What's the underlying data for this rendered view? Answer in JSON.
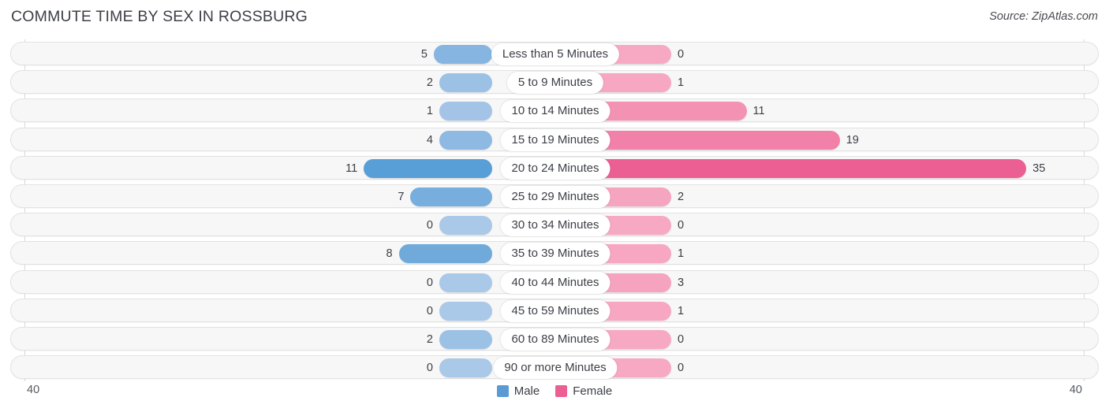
{
  "header": {
    "title": "COMMUTE TIME BY SEX IN ROSSBURG",
    "source": "Source: ZipAtlas.com"
  },
  "legend": {
    "items": [
      {
        "label": "Male",
        "color": "#5b9bd5"
      },
      {
        "label": "Female",
        "color": "#ec5f92"
      }
    ]
  },
  "axis": {
    "left_label": "40",
    "right_label": "40",
    "max": 40
  },
  "chart_data": {
    "type": "bar",
    "subtype": "diverging-bidirectional",
    "title": "COMMUTE TIME BY SEX IN ROSSBURG",
    "xlabel": "",
    "ylabel": "",
    "xlim": [
      40,
      0,
      40
    ],
    "grid": false,
    "legend_position": "bottom-center",
    "categories": [
      "Less than 5 Minutes",
      "5 to 9 Minutes",
      "10 to 14 Minutes",
      "15 to 19 Minutes",
      "20 to 24 Minutes",
      "25 to 29 Minutes",
      "30 to 34 Minutes",
      "35 to 39 Minutes",
      "40 to 44 Minutes",
      "45 to 59 Minutes",
      "60 to 89 Minutes",
      "90 or more Minutes"
    ],
    "series": [
      {
        "name": "Male",
        "direction": "left",
        "color": "#5b9bd5",
        "values": [
          5,
          2,
          1,
          4,
          11,
          7,
          0,
          8,
          0,
          0,
          2,
          0
        ]
      },
      {
        "name": "Female",
        "direction": "right",
        "color": "#ec5f92",
        "values": [
          0,
          1,
          11,
          19,
          35,
          2,
          0,
          1,
          3,
          1,
          0,
          0
        ]
      }
    ]
  },
  "rows": [
    {
      "label": "Less than 5 Minutes",
      "male": "5",
      "female": "0"
    },
    {
      "label": "5 to 9 Minutes",
      "male": "2",
      "female": "1"
    },
    {
      "label": "10 to 14 Minutes",
      "male": "1",
      "female": "11"
    },
    {
      "label": "15 to 19 Minutes",
      "male": "4",
      "female": "19"
    },
    {
      "label": "20 to 24 Minutes",
      "male": "11",
      "female": "35"
    },
    {
      "label": "25 to 29 Minutes",
      "male": "7",
      "female": "2"
    },
    {
      "label": "30 to 34 Minutes",
      "male": "0",
      "female": "0"
    },
    {
      "label": "35 to 39 Minutes",
      "male": "8",
      "female": "1"
    },
    {
      "label": "40 to 44 Minutes",
      "male": "0",
      "female": "3"
    },
    {
      "label": "45 to 59 Minutes",
      "male": "0",
      "female": "1"
    },
    {
      "label": "60 to 89 Minutes",
      "male": "2",
      "female": "0"
    },
    {
      "label": "90 or more Minutes",
      "male": "0",
      "female": "0"
    }
  ]
}
